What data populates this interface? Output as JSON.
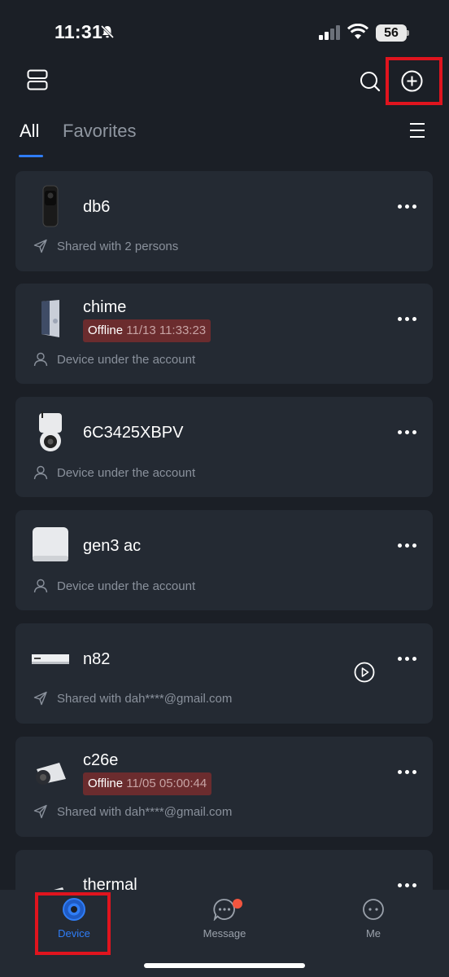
{
  "status_bar": {
    "time": "11:31",
    "battery": "56"
  },
  "tabs": {
    "all": "All",
    "favorites": "Favorites"
  },
  "devices": [
    {
      "name": "db6",
      "status": "",
      "timestamp": "",
      "subtitle": "Shared with 2 persons",
      "sub_icon": "share-icon"
    },
    {
      "name": "chime",
      "status": "Offline",
      "timestamp": "11/13 11:33:23",
      "subtitle": "Device under the account",
      "sub_icon": "person-icon"
    },
    {
      "name": "6C3425XBPV",
      "status": "",
      "timestamp": "",
      "subtitle": "Device under the account",
      "sub_icon": "person-icon"
    },
    {
      "name": "gen3 ac",
      "status": "",
      "timestamp": "",
      "subtitle": "Device under the account",
      "sub_icon": "person-icon"
    },
    {
      "name": "n82",
      "status": "",
      "timestamp": "",
      "subtitle": "Shared with dah****@gmail.com",
      "sub_icon": "share-icon"
    },
    {
      "name": "c26e",
      "status": "Offline",
      "timestamp": "11/05 05:00:44",
      "subtitle": "Shared with dah****@gmail.com",
      "sub_icon": "share-icon"
    },
    {
      "name": "thermal",
      "status": "",
      "timestamp": "",
      "subtitle": "",
      "sub_icon": ""
    }
  ],
  "bottom_nav": [
    {
      "label": "Device",
      "active": true
    },
    {
      "label": "Message",
      "active": false
    },
    {
      "label": "Me",
      "active": false
    }
  ],
  "colors": {
    "accent": "#2f7df6",
    "offline_badge": "#6b2c2e",
    "annotation": "#e0141e",
    "notification_dot": "#f2553f"
  }
}
